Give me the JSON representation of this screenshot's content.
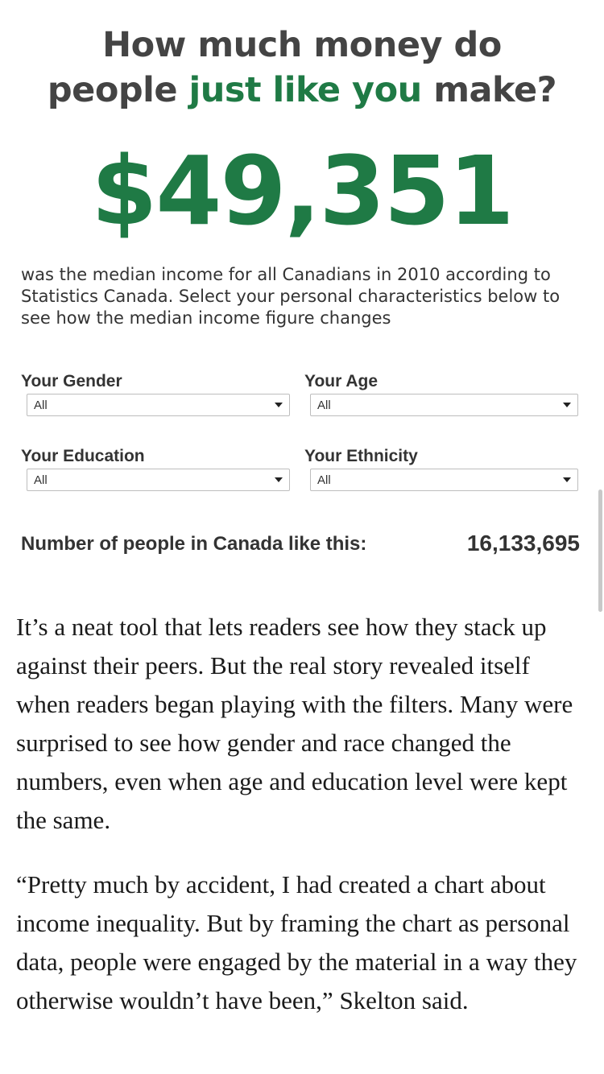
{
  "widget": {
    "headline_line1": "How much money do",
    "headline_line2_pre": "people ",
    "headline_line2_accent": "just like you",
    "headline_line2_post": " make?",
    "median_income": "$49,351",
    "intro": "was the median income for all Canadians in 2010 according to Statistics Canada. Select your personal characteristics below to see how the median income figure changes",
    "filters": {
      "gender": {
        "label": "Your Gender",
        "value": "All"
      },
      "age": {
        "label": "Your Age",
        "value": "All"
      },
      "education": {
        "label": "Your Education",
        "value": "All"
      },
      "ethnicity": {
        "label": "Your Ethnicity",
        "value": "All"
      }
    },
    "count_label": "Number of people in Canada like this:",
    "count_value": "16,133,695"
  },
  "article": {
    "paragraph1": "It’s a neat tool that lets readers see how they stack up against their peers. But the real story revealed itself when readers began playing with the filters. Many were surprised to see how gender and race changed the numbers, even when age and education level were kept the same.",
    "paragraph2": "“Pretty much by accident, I had created a chart about income inequality. But by framing the chart as personal data, people were engaged by the material in a way they otherwise wouldn’t have been,” Skelton said."
  },
  "colors": {
    "accent_green": "#1f7a45",
    "heading_gray": "#444444"
  }
}
